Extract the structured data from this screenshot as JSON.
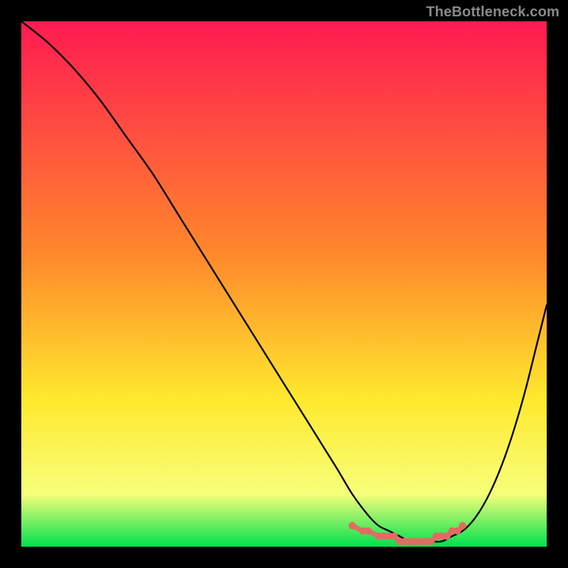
{
  "watermark": "TheBottleneck.com",
  "chart_data": {
    "type": "line",
    "title": "",
    "xlabel": "",
    "ylabel": "",
    "xlim": [
      0,
      100
    ],
    "ylim": [
      0,
      100
    ],
    "grid": false,
    "legend": false,
    "series": [
      {
        "name": "bottleneck-curve",
        "x": [
          0,
          5,
          10,
          15,
          20,
          25,
          30,
          35,
          40,
          45,
          50,
          55,
          60,
          63,
          66,
          68,
          70,
          72,
          74,
          76,
          78,
          80,
          82,
          84,
          86,
          88,
          90,
          92,
          94,
          96,
          98,
          100
        ],
        "y": [
          100,
          96,
          91,
          85,
          78,
          71,
          63,
          55,
          47,
          39,
          31,
          23,
          15,
          10,
          6,
          4,
          3,
          2,
          1,
          1,
          1,
          1,
          2,
          3,
          5,
          8,
          12,
          17,
          23,
          30,
          38,
          46
        ]
      }
    ],
    "markers": {
      "name": "sweet-spot",
      "color": "#e36a63",
      "x": [
        63,
        65,
        66,
        68,
        69,
        70,
        71,
        72,
        73,
        74,
        75,
        76,
        77,
        78,
        79,
        80,
        81,
        82,
        83,
        84
      ],
      "y": [
        4,
        3,
        3,
        2,
        2,
        2,
        2,
        1,
        1,
        1,
        1,
        1,
        1,
        1,
        2,
        2,
        2,
        3,
        3,
        4
      ]
    },
    "gradient": {
      "top": "#ff1a52",
      "mid1": "#ff8a2b",
      "mid2": "#ffe92e",
      "mid3": "#f6ff7a",
      "bottom": "#00e04e"
    }
  }
}
